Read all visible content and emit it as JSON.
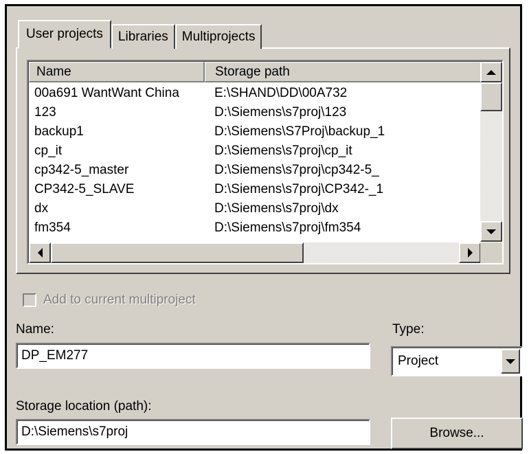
{
  "tabs": [
    {
      "label": "User projects",
      "active": true
    },
    {
      "label": "Libraries",
      "active": false
    },
    {
      "label": "Multiprojects",
      "active": false
    }
  ],
  "list": {
    "columns": [
      "Name",
      "Storage path"
    ],
    "rows": [
      {
        "name": "00a691 WantWant China",
        "path": "E:\\SHAND\\DD\\00A732"
      },
      {
        "name": "123",
        "path": "D:\\Siemens\\s7proj\\123"
      },
      {
        "name": "backup1",
        "path": "D:\\Siemens\\S7Proj\\backup_1"
      },
      {
        "name": "cp_it",
        "path": "D:\\Siemens\\s7proj\\cp_it"
      },
      {
        "name": "cp342-5_master",
        "path": "D:\\Siemens\\s7proj\\cp342-5_"
      },
      {
        "name": "CP342-5_SLAVE",
        "path": "D:\\Siemens\\s7proj\\CP342-_1"
      },
      {
        "name": "dx",
        "path": "D:\\Siemens\\s7proj\\dx"
      },
      {
        "name": "fm354",
        "path": "D:\\Siemens\\s7proj\\fm354"
      }
    ]
  },
  "form": {
    "add_to_multiproject_label": "Add to current multiproject",
    "add_to_multiproject_checked": false,
    "name_label": "Name:",
    "name_value": "DP_EM277",
    "type_label": "Type:",
    "type_value": "Project",
    "storage_label": "Storage location (path):",
    "storage_value": "D:\\Siemens\\s7proj",
    "browse_label": "Browse..."
  }
}
